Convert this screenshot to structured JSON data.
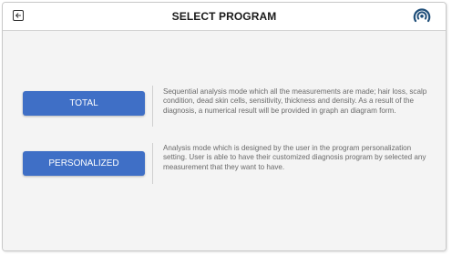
{
  "header": {
    "title": "SELECT PROGRAM",
    "back_icon": "arrow-left-icon",
    "logo_icon": "concentric-arc-logo",
    "accent_color": "#1f4e79"
  },
  "programs": [
    {
      "label": "TOTAL",
      "description": "Sequential analysis mode which all the measurements are made; hair loss, scalp condition, dead skin cells, sensitivity, thickness and density. As a result of the diagnosis, a numerical result will be provided in graph an diagram form."
    },
    {
      "label": "PERSONALIZED",
      "description": "Analysis mode which is designed by the user in the program personalization setting. User is able to have their customized diagnosis program by selected any measurement that they want to have."
    }
  ],
  "colors": {
    "button_bg": "#3f6fc6",
    "content_bg": "#f4f4f4",
    "description_text": "#6a6a6a"
  }
}
